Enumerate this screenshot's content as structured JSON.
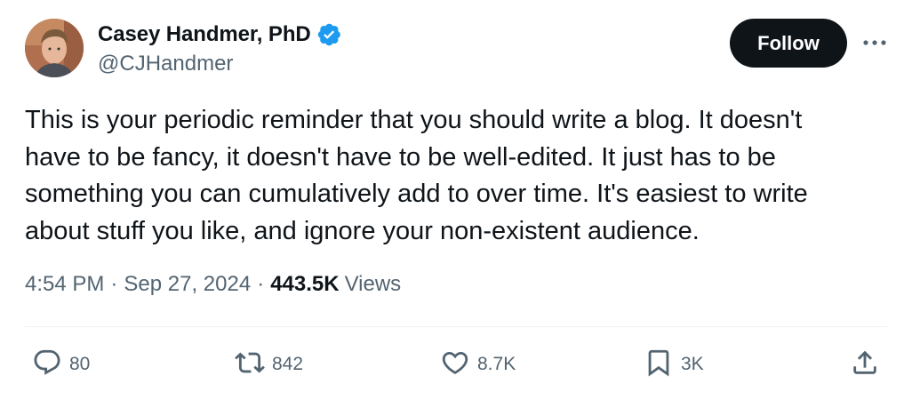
{
  "author": {
    "display_name": "Casey Handmer, PhD",
    "handle": "@CJHandmer",
    "verified": true,
    "verified_color": "#1d9bf0"
  },
  "follow_label": "Follow",
  "tweet": {
    "text": "This is your periodic reminder that you should write a blog. It doesn't\nhave to be fancy, it doesn't have to be well-edited. It just has to be\nsomething you can cumulatively add to over time. It's easiest to write\nabout stuff you like, and ignore your non-existent audience."
  },
  "meta": {
    "time": "4:54 PM",
    "separator": "·",
    "date": "Sep 27, 2024",
    "views_count": "443.5K",
    "views_label": "Views"
  },
  "actions": {
    "replies": "80",
    "reposts": "842",
    "likes": "8.7K",
    "bookmarks": "3K"
  },
  "icons": [
    "verified-badge-icon",
    "more-icon",
    "reply-icon",
    "repost-icon",
    "like-icon",
    "bookmark-icon",
    "share-icon"
  ],
  "colors": {
    "text_primary": "#0f1419",
    "text_secondary": "#536471",
    "follow_bg": "#0f1419",
    "divider": "#eff3f4"
  }
}
